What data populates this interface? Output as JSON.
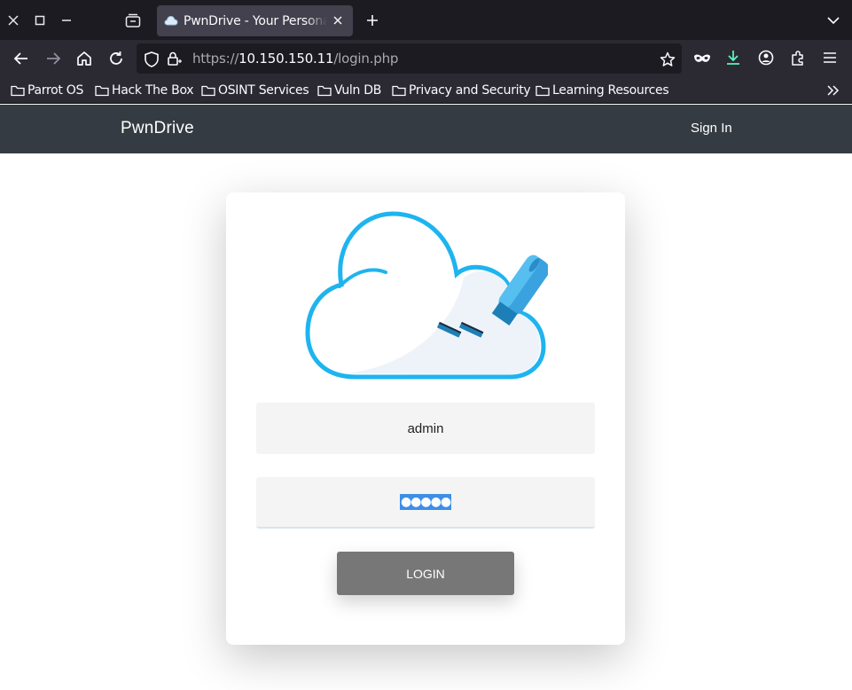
{
  "browser": {
    "tab_title": "PwnDrive - Your Personal",
    "url": {
      "scheme": "https://",
      "host": "10.150.150.11",
      "path": "/login.php"
    },
    "bookmarks": [
      {
        "label": "Parrot OS"
      },
      {
        "label": "Hack The Box"
      },
      {
        "label": "OSINT Services"
      },
      {
        "label": "Vuln DB"
      },
      {
        "label": "Privacy and Security"
      },
      {
        "label": "Learning Resources"
      }
    ]
  },
  "site": {
    "brand": "PwnDrive",
    "signin_label": "Sign In"
  },
  "login": {
    "username_value": "admin",
    "password_masked": "●●●●●",
    "button_label": "LOGIN"
  },
  "colors": {
    "cloud": "#1eb4ef",
    "header": "#353b42",
    "button": "#777777",
    "selection": "#3d8ee6"
  }
}
